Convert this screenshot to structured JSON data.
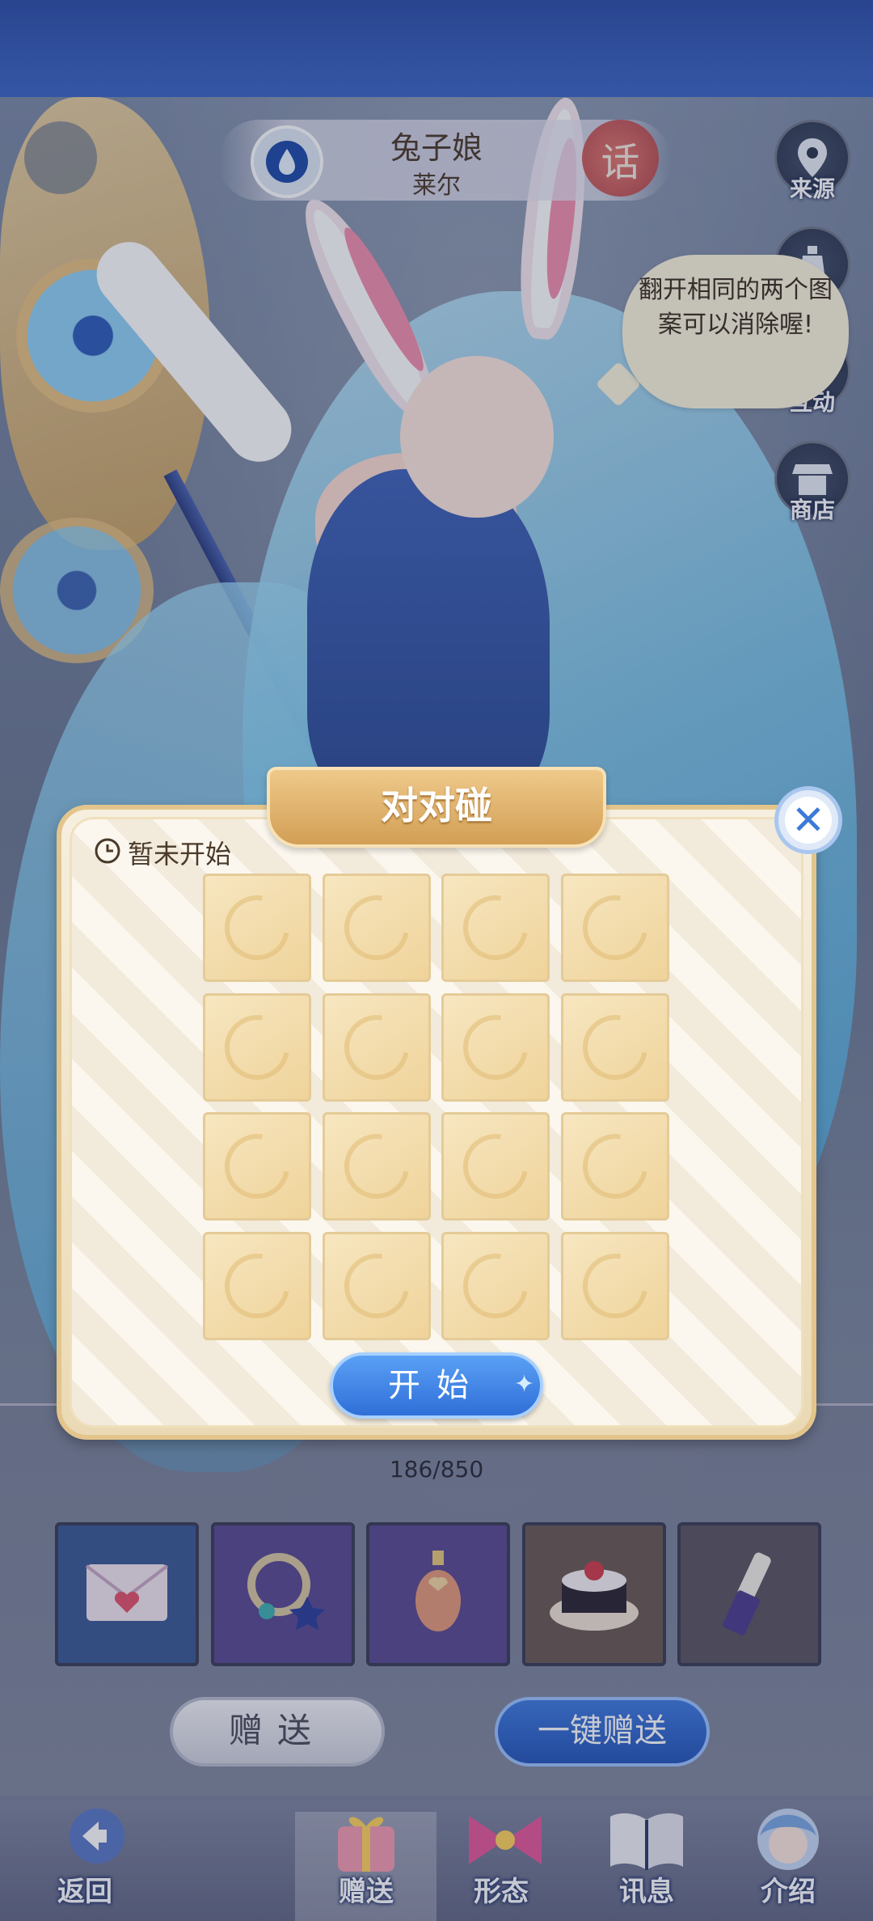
{
  "character": {
    "name": "兔子娘",
    "subname": "莱尔",
    "talk_badge": "话"
  },
  "side_menu": [
    {
      "label": "来源",
      "icon": "map-pin-icon"
    },
    {
      "label": "",
      "icon": "bottle-icon"
    },
    {
      "label": "互动",
      "icon": "heart-icon"
    },
    {
      "label": "商店",
      "icon": "shop-icon"
    }
  ],
  "speech": {
    "text": "翻开相同的两个图案可以消除喔!"
  },
  "dialog": {
    "title": "对对碰",
    "status": "暂未开始",
    "start_label": "开始",
    "close_icon": "close-icon",
    "grid": {
      "rows": 4,
      "cols": 4
    }
  },
  "gifts": {
    "progress": "186/850",
    "items": [
      {
        "icon": "love-letter-icon",
        "bg": "#3a5a95"
      },
      {
        "icon": "star-bracelet-icon",
        "bg": "#5a4a90"
      },
      {
        "icon": "perfume-bottle-icon",
        "bg": "#5a4a90"
      },
      {
        "icon": "cake-icon",
        "bg": "#6a5a55"
      },
      {
        "icon": "lipstick-icon",
        "bg": "#5a5560"
      }
    ],
    "give_label": "赠送",
    "one_key_label": "一键赠送"
  },
  "bottom_nav": [
    {
      "label": "返回",
      "icon": "back-arrow-icon"
    },
    {
      "label": "赠送",
      "icon": "gift-icon",
      "active": true
    },
    {
      "label": "形态",
      "icon": "bow-icon"
    },
    {
      "label": "讯息",
      "icon": "book-icon"
    },
    {
      "label": "介绍",
      "icon": "portrait-icon"
    }
  ],
  "colors": {
    "accent_blue": "#2f6fd8",
    "dialog_bg": "#fbf6ec",
    "card": "#efd39a",
    "ribbon": "#d29f55"
  }
}
